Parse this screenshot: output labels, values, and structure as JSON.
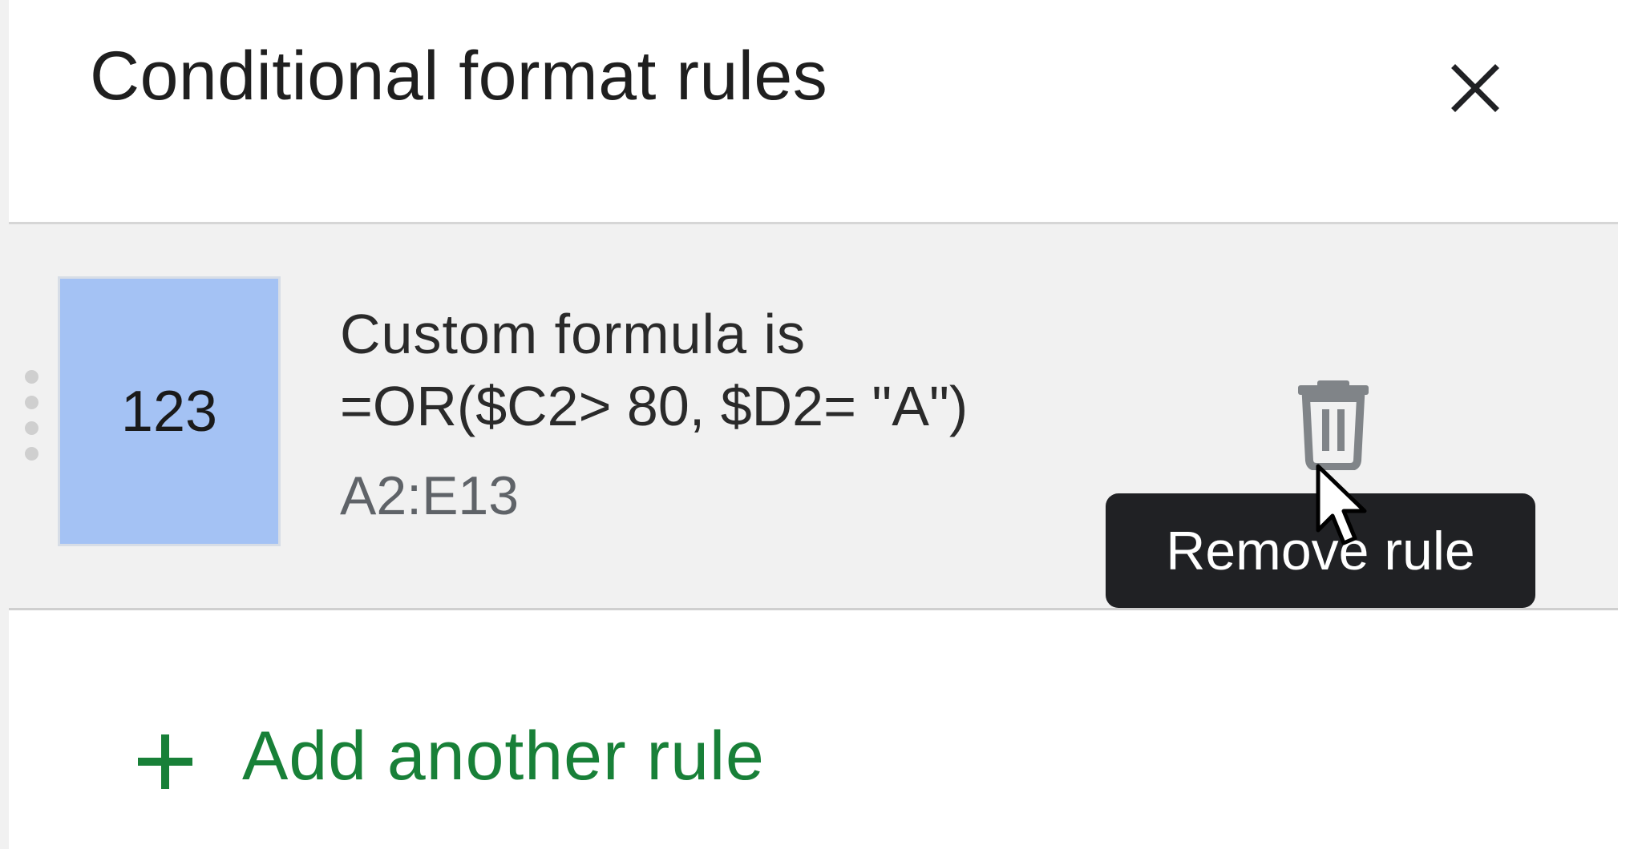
{
  "panel": {
    "title": "Conditional format rules",
    "close_icon": "close-icon"
  },
  "rule": {
    "preview_text": "123",
    "preview_background": "#a4c2f4",
    "condition_line1": "Custom formula is",
    "condition_line2": "=OR($C2> 80, $D2= \"A\")",
    "range": "A2:E13",
    "delete_icon": "trash-icon",
    "drag_icon": "drag-handle-icon"
  },
  "tooltip": {
    "text": "Remove rule"
  },
  "add_rule": {
    "label": "Add another rule",
    "icon": "plus-icon",
    "color": "#188038"
  }
}
